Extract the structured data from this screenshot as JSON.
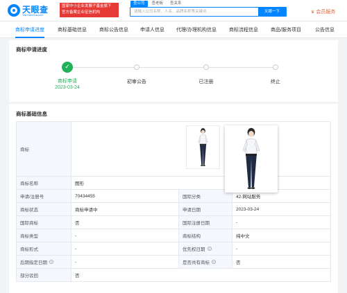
{
  "header": {
    "logo_text": "天眼查",
    "logo_domain": "TianYanCha.com",
    "banner_lines": [
      "国家中小企业发展子基金旗下",
      "官方备案企业征信机构"
    ],
    "search_tabs": [
      "查公司",
      "查老板",
      "查关系"
    ],
    "search_placeholder": "请输入公司名称、人名、品牌名称等关键词",
    "search_button": "天眼一下",
    "vip_label": "会员服务"
  },
  "tabs": [
    {
      "label": "商标申请进度",
      "active": true
    },
    {
      "label": "商标基础信息"
    },
    {
      "label": "商标公告信息"
    },
    {
      "label": "申请人信息"
    },
    {
      "label": "代理/办理机构信息"
    },
    {
      "label": "商标流程信息"
    },
    {
      "label": "商品/服务项目"
    },
    {
      "label": "公告信息"
    }
  ],
  "progress": {
    "title": "商标申请进度",
    "steps": [
      {
        "label": "商标申请",
        "date": "2023-03-24",
        "done": true
      },
      {
        "label": "初审公告"
      },
      {
        "label": "已注册"
      },
      {
        "label": "终止"
      }
    ]
  },
  "basic_info": {
    "title": "商标基础信息",
    "trademark_label": "商标",
    "rows": [
      {
        "k1": "商标名称",
        "v1": "图形"
      },
      {
        "k1": "申请/注册号",
        "v1": "70434455",
        "k2": "国际分类",
        "v2": "42-网站服务"
      },
      {
        "k1": "商标状态",
        "v1": "商标申请中",
        "k2": "申请日期",
        "v2": "2023-03-24"
      },
      {
        "k1": "国际商标",
        "v1": "否",
        "k2": "国际注册日期",
        "v2": "-"
      },
      {
        "k1": "商标类型",
        "v1": "-",
        "k2": "商标结构",
        "v2": "纯中文"
      },
      {
        "k1": "商标形式",
        "v1": "-",
        "k2": "优先权日期",
        "v2": "-"
      },
      {
        "k1": "后期指定日期",
        "v1": "-",
        "k2": "是否共有商标",
        "v2": "否"
      },
      {
        "k1": "部分驳回",
        "v1": "否"
      }
    ]
  },
  "colors": {
    "brand": "#0084ff",
    "success": "#22b25a",
    "banner": "#e53935",
    "vip": "#e8643b"
  }
}
